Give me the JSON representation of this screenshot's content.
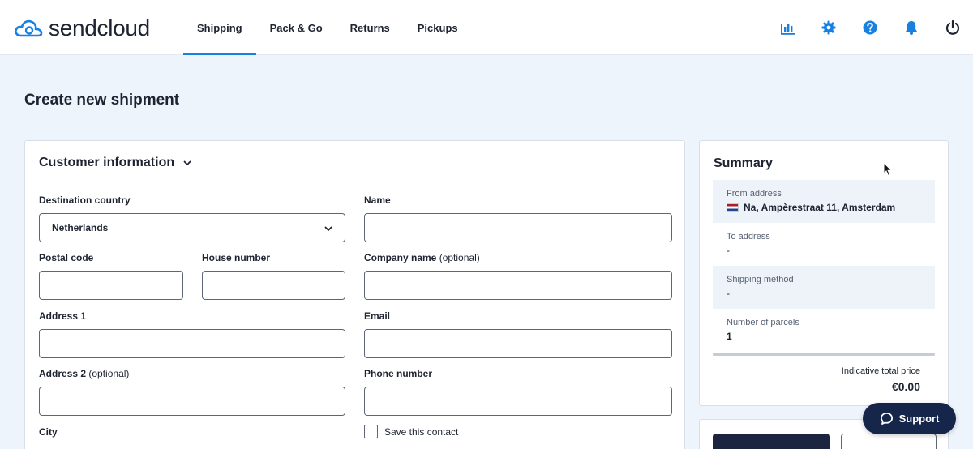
{
  "brand": {
    "name": "sendcloud",
    "accent": "#1780e0"
  },
  "nav": {
    "tabs": [
      {
        "label": "Shipping",
        "active": true
      },
      {
        "label": "Pack & Go",
        "active": false
      },
      {
        "label": "Returns",
        "active": false
      },
      {
        "label": "Pickups",
        "active": false
      }
    ],
    "icons": [
      "analytics-icon",
      "gear-icon",
      "help-icon",
      "bell-icon",
      "power-icon"
    ]
  },
  "page": {
    "title": "Create new shipment"
  },
  "customer": {
    "heading": "Customer information",
    "destination_country": {
      "label": "Destination country",
      "value": "Netherlands"
    },
    "name": {
      "label": "Name",
      "value": ""
    },
    "postal_code": {
      "label": "Postal code",
      "value": ""
    },
    "house_number": {
      "label": "House number",
      "value": ""
    },
    "company_name": {
      "label": "Company name",
      "optional": "(optional)",
      "value": ""
    },
    "address1": {
      "label": "Address 1",
      "value": ""
    },
    "email": {
      "label": "Email",
      "value": ""
    },
    "address2": {
      "label": "Address 2",
      "optional": "(optional)",
      "value": ""
    },
    "phone": {
      "label": "Phone number",
      "value": ""
    },
    "city": {
      "label": "City"
    },
    "save_contact": {
      "label": "Save this contact",
      "checked": false
    }
  },
  "summary": {
    "title": "Summary",
    "from_address": {
      "label": "From address",
      "value": "Na, Ampèrestraat 11, Amsterdam"
    },
    "to_address": {
      "label": "To address",
      "value": "-"
    },
    "shipping_method": {
      "label": "Shipping method",
      "value": "-"
    },
    "parcels": {
      "label": "Number of parcels",
      "value": "1"
    },
    "price_label": "Indicative total price",
    "price_value": "€0.00"
  },
  "support": {
    "label": "Support"
  }
}
